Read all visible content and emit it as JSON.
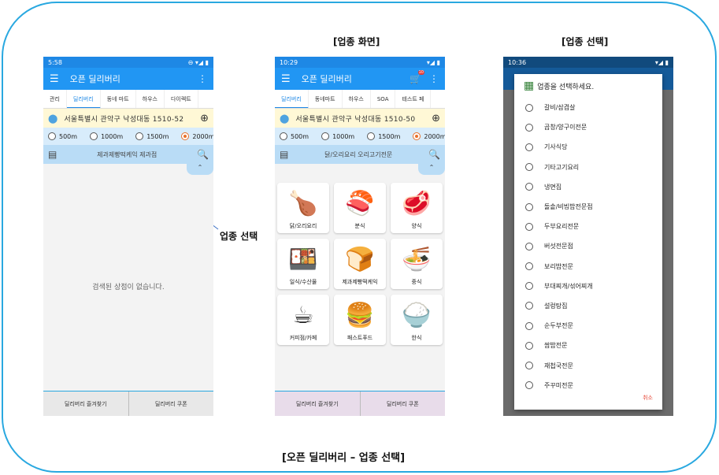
{
  "captions": {
    "middle": "[업종 화면]",
    "right": "[업종 선택]",
    "annotation": "업종 선택",
    "bottom": "[오픈 딜리버리 – 업종 선택]"
  },
  "phone1": {
    "time": "5:58",
    "status_icons": "⊖ ▾◢ ▮",
    "app_title": "오픈 딜리버리",
    "tabs": [
      "관리",
      "딜리버리",
      "동네 마트",
      "하우스",
      "다이렉트"
    ],
    "active_tab": 1,
    "address": "서울특별시 관악구 낙성대동 1510-52",
    "radios": [
      "500m",
      "1000m",
      "1500m",
      "2000m"
    ],
    "selected_radio": 3,
    "search_text": "제과제빵떡케익 제과점",
    "empty_text": "검색된 상점이 없습니다.",
    "bottom": [
      "딜리버리 즐겨찾기",
      "딜리버리 쿠폰"
    ],
    "accent": "#2196f3",
    "bottom_bg": "#e8e8e8"
  },
  "phone2": {
    "time": "10:29",
    "status_icons": "▾◢ ▮",
    "app_title": "오픈 딜리버리",
    "cart_badge": "10",
    "tabs": [
      "딜리버리",
      "동네마트",
      "하우스",
      "SOA",
      "테스트 페"
    ],
    "active_tab": 0,
    "address": "서울특별시 관악구 낙성대동 1510-50",
    "radios": [
      "500m",
      "1000m",
      "1500m",
      "2000m"
    ],
    "selected_radio": 3,
    "search_text": "닭/오리요리 오리고기전문",
    "categories": [
      {
        "label": "닭/오리요리",
        "icon": "chicken-icon",
        "glyph": "🍗"
      },
      {
        "label": "분식",
        "icon": "sushi-icon",
        "glyph": "🍣"
      },
      {
        "label": "양식",
        "icon": "meat-icon",
        "glyph": "🥩"
      },
      {
        "label": "일식/수산물",
        "icon": "sashimi-icon",
        "glyph": "🍱"
      },
      {
        "label": "제과제빵떡케익",
        "icon": "bread-icon",
        "glyph": "🍞"
      },
      {
        "label": "중식",
        "icon": "noodle-icon",
        "glyph": "🍜"
      },
      {
        "label": "커피점/카페",
        "icon": "coffee-icon",
        "glyph": "☕"
      },
      {
        "label": "패스트푸드",
        "icon": "burger-icon",
        "glyph": "🍔"
      },
      {
        "label": "한식",
        "icon": "rice-bowl-icon",
        "glyph": "🍚"
      }
    ],
    "bottom": [
      "딜리버리 즐겨찾기",
      "딜리버리 쿠폰"
    ],
    "bottom_bg": "#e8dcea"
  },
  "phone3": {
    "time": "10:36",
    "status_icons": "▾◢ ▮",
    "dialog_title": "업종을 선택하세요.",
    "options": [
      "갈비/삼겹살",
      "곱창/양구이전문",
      "기사식당",
      "기타고기요리",
      "냉면집",
      "돌솥/비빔밥전문점",
      "두부요리전문",
      "버섯전문점",
      "보리밥전문",
      "부대찌개/섞어찌개",
      "설렁탕집",
      "순두부전문",
      "쌈밥전문",
      "재첩국전문",
      "주꾸미전문"
    ],
    "cancel": "취소"
  }
}
